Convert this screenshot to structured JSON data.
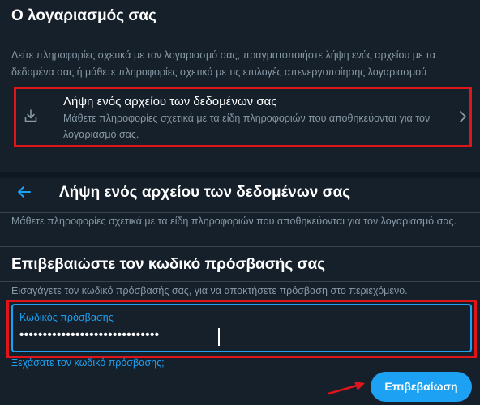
{
  "account": {
    "title": "Ο λογαριασμός σας",
    "description": "Δείτε πληροφορίες σχετικά με τον λογαριασμό σας, πραγματοποιήστε λήψη ενός αρχείου με τα δεδομένα σας ή μάθετε πληροφορίες σχετικά με τις επιλογές απενεργοποίησης λογαριασμού",
    "download_item": {
      "icon": "download-icon",
      "title": "Λήψη ενός αρχείου των δεδομένων σας",
      "subtitle": "Μάθετε πληροφορίες σχετικά με τα είδη πληροφοριών που αποθηκεύονται για τον λογαριασμό σας."
    }
  },
  "download_page": {
    "title": "Λήψη ενός αρχείου των δεδομένων σας",
    "description": "Μάθετε πληροφορίες σχετικά με τα είδη πληροφοριών που αποθηκεύονται για τον λογαριασμό σας.",
    "confirm_heading": "Επιβεβαιώστε τον κωδικό πρόσβασής σας",
    "confirm_description": "Εισαγάγετε τον κωδικό πρόσβασής σας, για να αποκτήσετε πρόσβαση στο περιεχόμενο.",
    "password_label": "Κωδικός πρόσβασης",
    "password_value": "••••••••••••••••••••••••••••••",
    "forgot_link": "Ξεχάσατε τον κωδικό πρόσβασης;",
    "confirm_button": "Επιβεβαίωση"
  },
  "colors": {
    "background": "#15202b",
    "accent": "#1da1f2",
    "muted": "#8899a6",
    "highlight": "#e0151b"
  }
}
